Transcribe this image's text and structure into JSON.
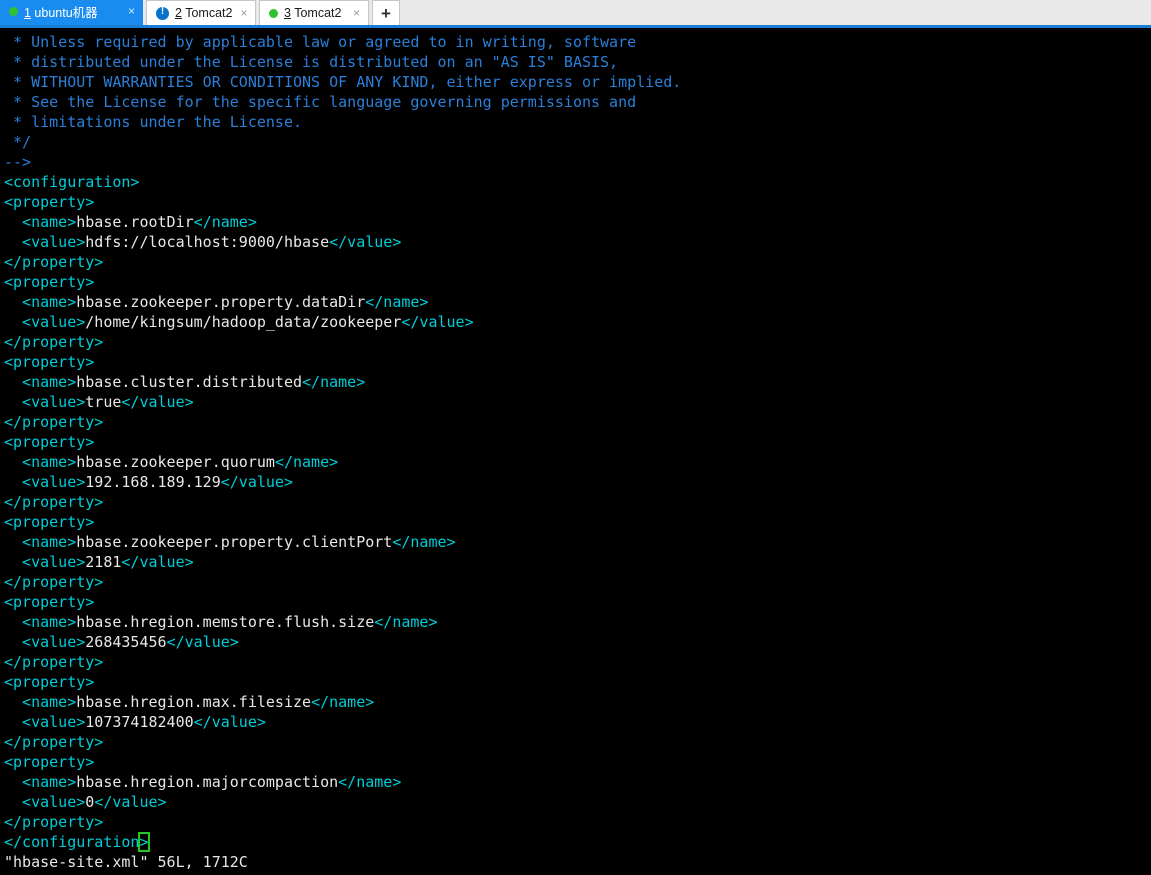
{
  "window": {
    "app": "terminal-tabs"
  },
  "tabs": {
    "items": [
      {
        "index": "1",
        "label": " ubuntu机器",
        "status_icon": "green-dot",
        "close_glyph": "×",
        "active": true
      },
      {
        "index": "2",
        "label": " Tomcat2",
        "status_icon": "blue-alert",
        "close_glyph": "×",
        "active": false
      },
      {
        "index": "3",
        "label": " Tomcat2",
        "status_icon": "green-dot",
        "close_glyph": "×",
        "active": false
      }
    ],
    "new_tab_glyph": "+"
  },
  "colors": {
    "tab_active_bg": "#1a8cf0",
    "tab_strip_bg": "#e9e9e9",
    "accent_underline": "#1a7fd4",
    "terminal_bg": "#000000",
    "comment": "#2b7fd8",
    "xml_tag": "#00cdd7",
    "xml_text": "#e8e8e8",
    "cursor_outline": "#26c626",
    "status_dot_green": "#2fc22f",
    "alert_icon_blue": "#0a72c8"
  },
  "terminal": {
    "editor": "vim",
    "lines": [
      {
        "segments": [
          {
            "t": " * Unless required by applicable law or agreed to in writing, software",
            "c": "comment"
          }
        ]
      },
      {
        "segments": [
          {
            "t": " * distributed under the License is distributed on an \"AS IS\" BASIS,",
            "c": "comment"
          }
        ]
      },
      {
        "segments": [
          {
            "t": " * WITHOUT WARRANTIES OR CONDITIONS OF ANY KIND, either express or implied.",
            "c": "comment"
          }
        ]
      },
      {
        "segments": [
          {
            "t": " * See the License for the specific language governing permissions and",
            "c": "comment"
          }
        ]
      },
      {
        "segments": [
          {
            "t": " * limitations under the License.",
            "c": "comment"
          }
        ]
      },
      {
        "segments": [
          {
            "t": " */",
            "c": "comment"
          }
        ]
      },
      {
        "segments": [
          {
            "t": "-->",
            "c": "comment"
          }
        ]
      },
      {
        "segments": [
          {
            "t": "<configuration>",
            "c": "tag"
          }
        ]
      },
      {
        "segments": [
          {
            "t": "<property>",
            "c": "tag"
          }
        ]
      },
      {
        "segments": [
          {
            "t": "  <name>",
            "c": "tag"
          },
          {
            "t": "hbase.rootDir",
            "c": "text"
          },
          {
            "t": "</name>",
            "c": "tag"
          }
        ]
      },
      {
        "segments": [
          {
            "t": "  <value>",
            "c": "tag"
          },
          {
            "t": "hdfs://localhost:9000/hbase",
            "c": "text"
          },
          {
            "t": "</value>",
            "c": "tag"
          }
        ]
      },
      {
        "segments": [
          {
            "t": "</property>",
            "c": "tag"
          }
        ]
      },
      {
        "segments": [
          {
            "t": "<property>",
            "c": "tag"
          }
        ]
      },
      {
        "segments": [
          {
            "t": "  <name>",
            "c": "tag"
          },
          {
            "t": "hbase.zookeeper.property.dataDir",
            "c": "text"
          },
          {
            "t": "</name>",
            "c": "tag"
          }
        ]
      },
      {
        "segments": [
          {
            "t": "  <value>",
            "c": "tag"
          },
          {
            "t": "/home/kingsum/hadoop_data/zookeeper",
            "c": "text"
          },
          {
            "t": "</value>",
            "c": "tag"
          }
        ]
      },
      {
        "segments": [
          {
            "t": "</property>",
            "c": "tag"
          }
        ]
      },
      {
        "segments": [
          {
            "t": "<property>",
            "c": "tag"
          }
        ]
      },
      {
        "segments": [
          {
            "t": "  <name>",
            "c": "tag"
          },
          {
            "t": "hbase.cluster.distributed",
            "c": "text"
          },
          {
            "t": "</name>",
            "c": "tag"
          }
        ]
      },
      {
        "segments": [
          {
            "t": "  <value>",
            "c": "tag"
          },
          {
            "t": "true",
            "c": "text"
          },
          {
            "t": "</value>",
            "c": "tag"
          }
        ]
      },
      {
        "segments": [
          {
            "t": "</property>",
            "c": "tag"
          }
        ]
      },
      {
        "segments": [
          {
            "t": "<property>",
            "c": "tag"
          }
        ]
      },
      {
        "segments": [
          {
            "t": "  <name>",
            "c": "tag"
          },
          {
            "t": "hbase.zookeeper.quorum",
            "c": "text"
          },
          {
            "t": "</name>",
            "c": "tag"
          }
        ]
      },
      {
        "segments": [
          {
            "t": "  <value>",
            "c": "tag"
          },
          {
            "t": "192.168.189.129",
            "c": "text"
          },
          {
            "t": "</value>",
            "c": "tag"
          }
        ]
      },
      {
        "segments": [
          {
            "t": "</property>",
            "c": "tag"
          }
        ]
      },
      {
        "segments": [
          {
            "t": "<property>",
            "c": "tag"
          }
        ]
      },
      {
        "segments": [
          {
            "t": "  <name>",
            "c": "tag"
          },
          {
            "t": "hbase.zookeeper.property.clientPort",
            "c": "text"
          },
          {
            "t": "</name>",
            "c": "tag"
          }
        ]
      },
      {
        "segments": [
          {
            "t": "  <value>",
            "c": "tag"
          },
          {
            "t": "2181",
            "c": "text"
          },
          {
            "t": "</value>",
            "c": "tag"
          }
        ]
      },
      {
        "segments": [
          {
            "t": "</property>",
            "c": "tag"
          }
        ]
      },
      {
        "segments": [
          {
            "t": "<property>",
            "c": "tag"
          }
        ]
      },
      {
        "segments": [
          {
            "t": "  <name>",
            "c": "tag"
          },
          {
            "t": "hbase.hregion.memstore.flush.size",
            "c": "text"
          },
          {
            "t": "</name>",
            "c": "tag"
          }
        ]
      },
      {
        "segments": [
          {
            "t": "  <value>",
            "c": "tag"
          },
          {
            "t": "268435456",
            "c": "text"
          },
          {
            "t": "</value>",
            "c": "tag"
          }
        ]
      },
      {
        "segments": [
          {
            "t": "</property>",
            "c": "tag"
          }
        ]
      },
      {
        "segments": [
          {
            "t": "<property>",
            "c": "tag"
          }
        ]
      },
      {
        "segments": [
          {
            "t": "  <name>",
            "c": "tag"
          },
          {
            "t": "hbase.hregion.max.filesize",
            "c": "text"
          },
          {
            "t": "</name>",
            "c": "tag"
          }
        ]
      },
      {
        "segments": [
          {
            "t": "  <value>",
            "c": "tag"
          },
          {
            "t": "107374182400",
            "c": "text"
          },
          {
            "t": "</value>",
            "c": "tag"
          }
        ]
      },
      {
        "segments": [
          {
            "t": "</property>",
            "c": "tag"
          }
        ]
      },
      {
        "segments": [
          {
            "t": "<property>",
            "c": "tag"
          }
        ]
      },
      {
        "segments": [
          {
            "t": "  <name>",
            "c": "tag"
          },
          {
            "t": "hbase.hregion.majorcompaction",
            "c": "text"
          },
          {
            "t": "</name>",
            "c": "tag"
          }
        ]
      },
      {
        "segments": [
          {
            "t": "  <value>",
            "c": "tag"
          },
          {
            "t": "0",
            "c": "text"
          },
          {
            "t": "</value>",
            "c": "tag"
          }
        ]
      },
      {
        "segments": [
          {
            "t": "</property>",
            "c": "tag"
          }
        ]
      },
      {
        "segments": [
          {
            "t": "</configuration",
            "c": "tag"
          },
          {
            "t": ">",
            "c": "tag",
            "cursor": true
          }
        ]
      },
      {
        "segments": [
          {
            "t": "\"hbase-site.xml\" 56L, 1712C",
            "c": "status"
          }
        ]
      }
    ]
  }
}
